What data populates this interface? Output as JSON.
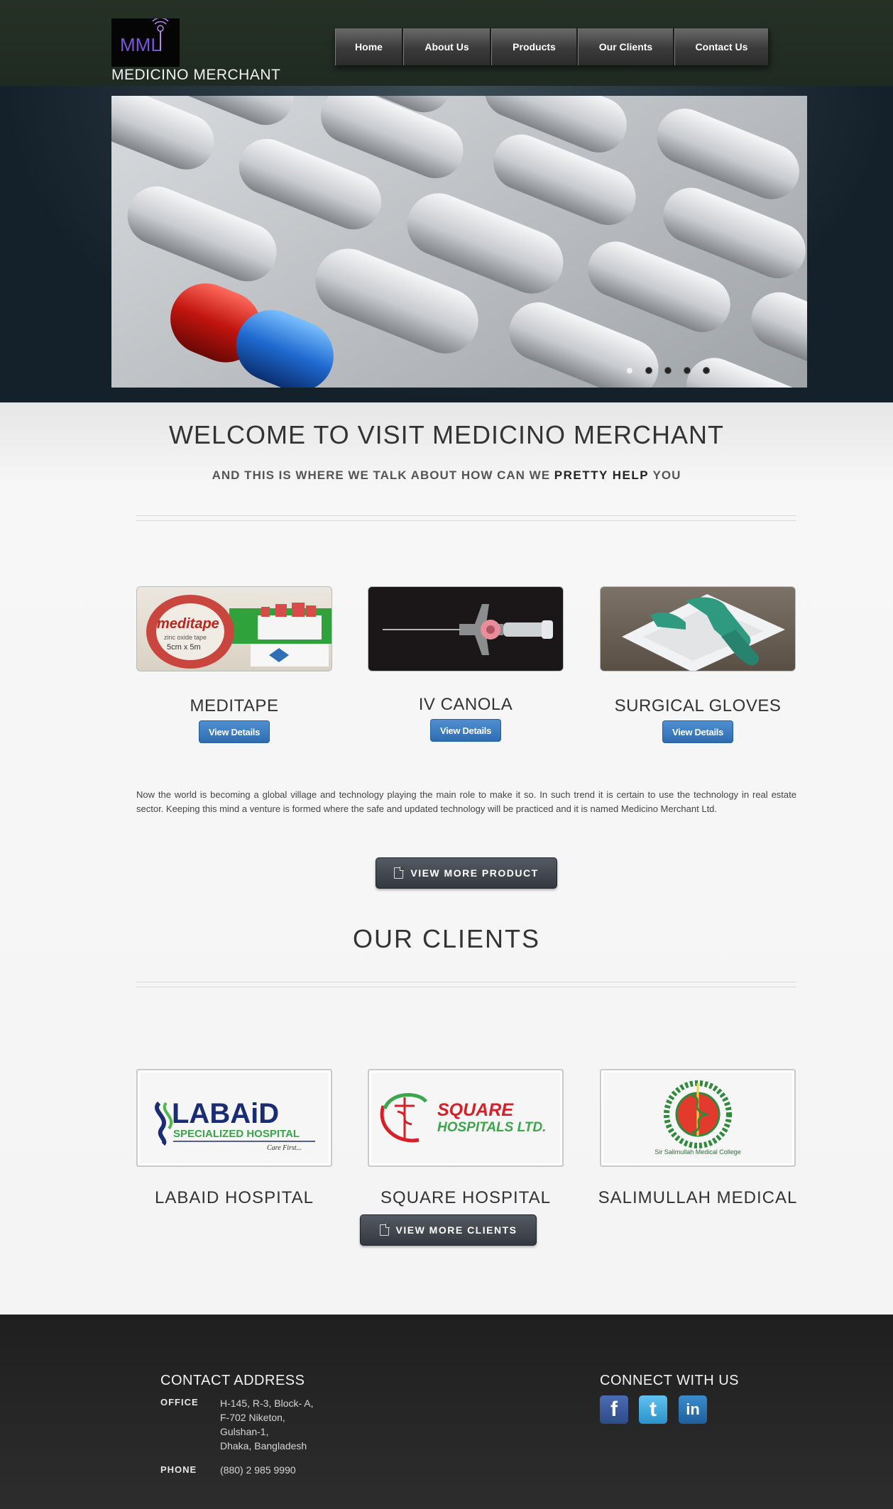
{
  "header": {
    "logo_text": "MML",
    "site_name": "MEDICINO MERCHANT",
    "nav": [
      "Home",
      "About Us",
      "Products",
      "Our Clients",
      "Contact Us"
    ]
  },
  "slider": {
    "slides_count": 5,
    "active_index": 0
  },
  "welcome": {
    "title": "WELCOME TO VISIT MEDICINO MERCHANT",
    "subtitle_pre": "AND THIS IS WHERE WE TALK ABOUT HOW CAN WE",
    "subtitle_bold": "PRETTY HELP",
    "subtitle_post": "YOU"
  },
  "products": [
    {
      "name": "MEDITAPE",
      "button": "View Details",
      "image_label": "meditape",
      "image_caption": "zinc oxide tape",
      "image_size": "5cm x 5m"
    },
    {
      "name": "IV CANOLA",
      "button": "View Details"
    },
    {
      "name": "SURGICAL GLOVES",
      "button": "View Details"
    }
  ],
  "about_text": "Now the world is becoming a global village and technology playing the main role to make it so. In such trend it is certain to use the technology in real estate sector. Keeping this mind a venture is formed where the safe and updated technology will be practiced and it is named Medicino Merchant Ltd.",
  "view_more_product": "VIEW MORE PRODUCT",
  "clients": {
    "title": "OUR CLIENTS",
    "items": [
      {
        "name": "LABAID HOSPITAL",
        "logo_line1": "LABAiD",
        "logo_line2": "SPECIALIZED HOSPITAL",
        "logo_line3": "Care First..."
      },
      {
        "name": "SQUARE HOSPITAL",
        "logo_line1": "SQUARE",
        "logo_line2": "HOSPITALS LTD."
      },
      {
        "name": "SALIMULLAH MEDICAL",
        "logo_line1": "Sir Salimullah Medical College"
      }
    ],
    "view_more": "VIEW MORE CLIENTS"
  },
  "footer": {
    "contact_title": "CONTACT ADDRESS",
    "office_label": "OFFICE",
    "office_lines": [
      "H-145, R-3, Block- A,",
      "F-702 Niketon,",
      "Gulshan-1,",
      "Dhaka, Bangladesh"
    ],
    "phone_label": "PHONE",
    "phone": "(880) 2 985 9990",
    "connect_title": "CONNECT WITH US",
    "social": [
      {
        "icon": "facebook-icon",
        "glyph": "f",
        "color": "#3b5998"
      },
      {
        "icon": "twitter-icon",
        "glyph": "t",
        "color": "#3fa9e0"
      },
      {
        "icon": "linkedin-icon",
        "glyph": "in",
        "color": "#2a77b5"
      }
    ]
  }
}
